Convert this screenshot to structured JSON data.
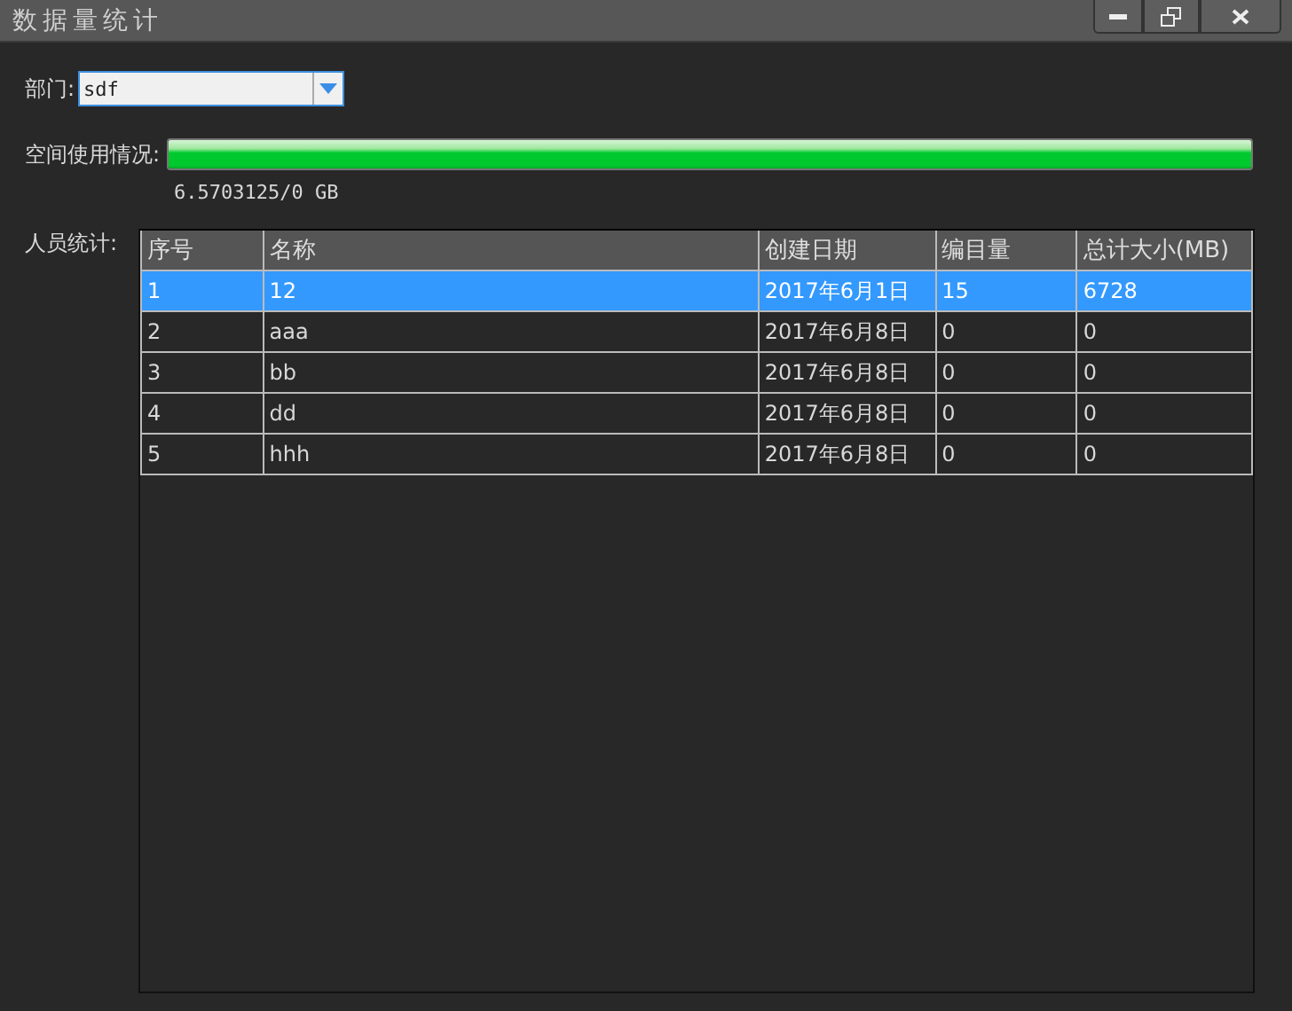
{
  "window": {
    "title": "数据量统计",
    "controls": [
      {
        "kind": "minimize"
      },
      {
        "kind": "restore"
      },
      {
        "kind": "close"
      }
    ]
  },
  "department": {
    "label": "部门:",
    "value": "sdf"
  },
  "space": {
    "label": "空间使用情况:",
    "level": 1,
    "reading": "6.5703125/0 GB"
  },
  "staff": {
    "label": "人员统计:",
    "table": {
      "columns": [
        "序号",
        "名称",
        "创建日期",
        "编目量",
        "总计大小(MB)"
      ],
      "rows": [
        {
          "cells": [
            "1",
            "12",
            "2017年6月1日",
            "15",
            "6728"
          ],
          "selected": true
        },
        {
          "cells": [
            "2",
            "aaa",
            "2017年6月8日",
            "0",
            "0"
          ],
          "selected": false
        },
        {
          "cells": [
            "3",
            "bb",
            "2017年6月8日",
            "0",
            "0"
          ],
          "selected": false
        },
        {
          "cells": [
            "4",
            "dd",
            "2017年6月8日",
            "0",
            "0"
          ],
          "selected": false
        },
        {
          "cells": [
            "5",
            "hhh",
            "2017年6月8日",
            "0",
            "0"
          ],
          "selected": false
        }
      ]
    }
  }
}
